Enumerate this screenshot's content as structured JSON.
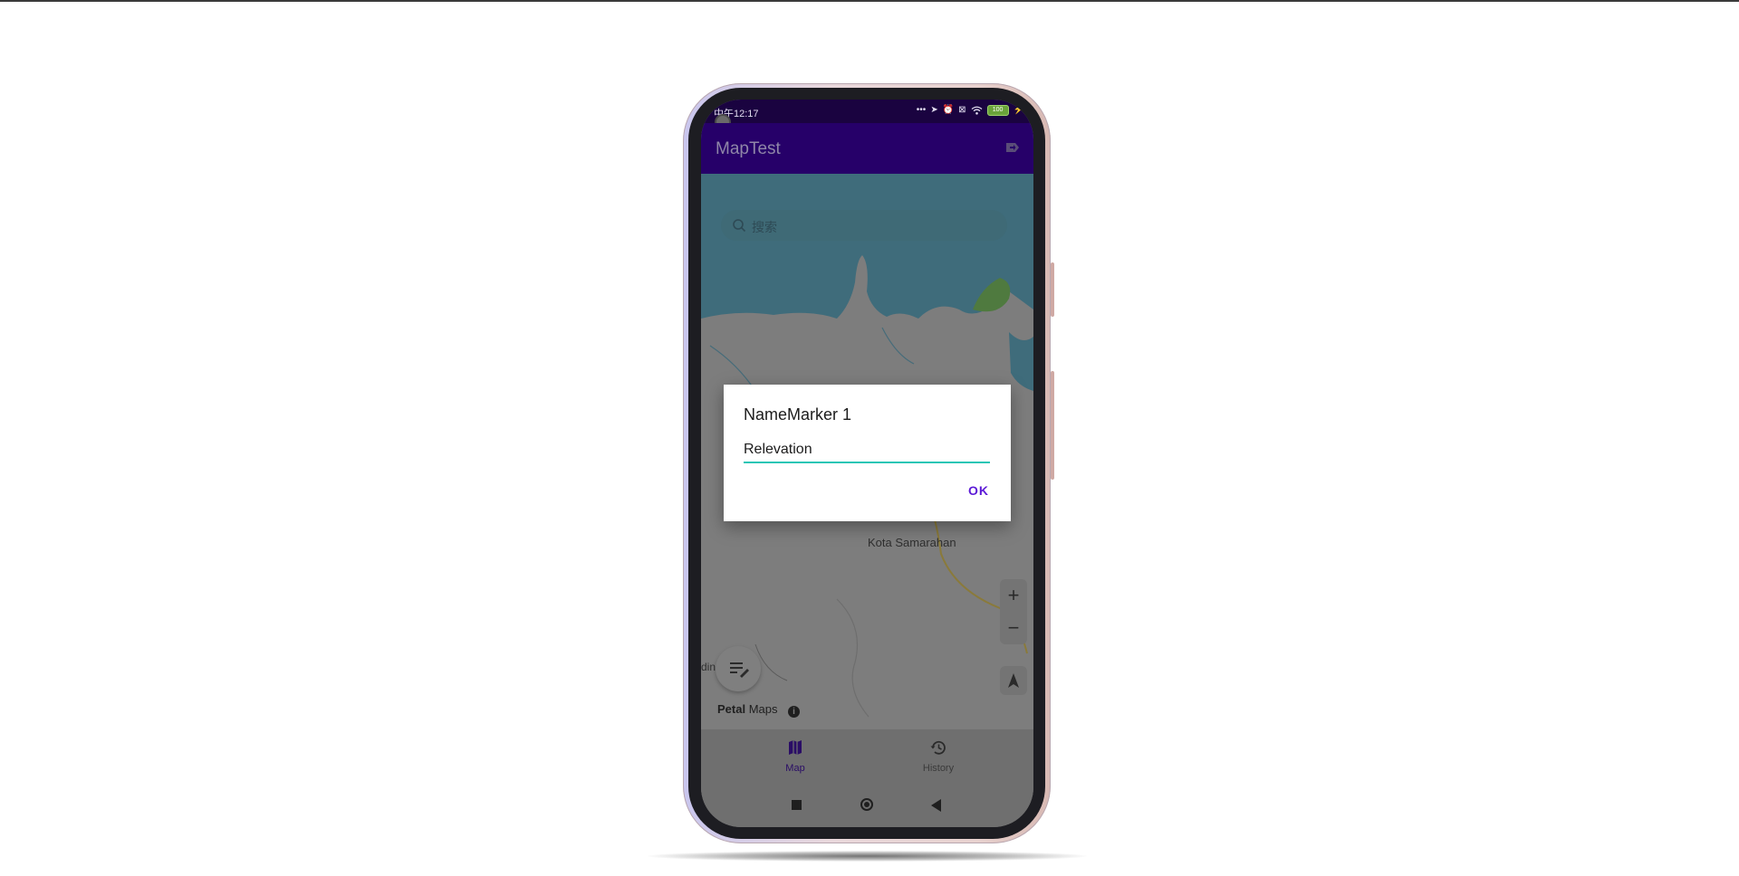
{
  "status_bar": {
    "time": "中午12:17",
    "battery": "100"
  },
  "app_bar": {
    "title": "MapTest",
    "action_icon": "directions-icon"
  },
  "map": {
    "search_placeholder": "搜索",
    "town_label": "Kota Samarahan",
    "edge_label": "din",
    "brand_bold": "Petal",
    "brand_rest": " Maps",
    "zoom_in": "+",
    "zoom_out": "−"
  },
  "bottom_nav": {
    "items": [
      {
        "label": "Map",
        "icon": "map-icon",
        "selected": true
      },
      {
        "label": "History",
        "icon": "history-icon",
        "selected": false
      }
    ]
  },
  "dialog": {
    "title": "NameMarker 1",
    "input_value": "Relevation",
    "ok_label": "OK"
  },
  "colors": {
    "app_bar": "#260069",
    "accent": "#5b19d6",
    "input_underline": "#26c6b5"
  }
}
